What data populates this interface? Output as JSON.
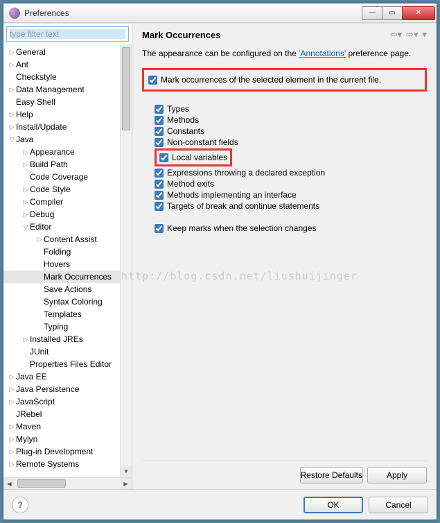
{
  "window": {
    "title": "Preferences"
  },
  "filter": {
    "placeholder": "type filter text"
  },
  "tree": [
    {
      "label": "General",
      "lvl": 0,
      "arrow": "right"
    },
    {
      "label": "Ant",
      "lvl": 0,
      "arrow": "right"
    },
    {
      "label": "Checkstyle",
      "lvl": 0,
      "arrow": "none"
    },
    {
      "label": "Data Management",
      "lvl": 0,
      "arrow": "right"
    },
    {
      "label": "Easy Shell",
      "lvl": 0,
      "arrow": "none"
    },
    {
      "label": "Help",
      "lvl": 0,
      "arrow": "right"
    },
    {
      "label": "Install/Update",
      "lvl": 0,
      "arrow": "right"
    },
    {
      "label": "Java",
      "lvl": 0,
      "arrow": "down"
    },
    {
      "label": "Appearance",
      "lvl": 1,
      "arrow": "right"
    },
    {
      "label": "Build Path",
      "lvl": 1,
      "arrow": "right"
    },
    {
      "label": "Code Coverage",
      "lvl": 1,
      "arrow": "none"
    },
    {
      "label": "Code Style",
      "lvl": 1,
      "arrow": "right"
    },
    {
      "label": "Compiler",
      "lvl": 1,
      "arrow": "right"
    },
    {
      "label": "Debug",
      "lvl": 1,
      "arrow": "right"
    },
    {
      "label": "Editor",
      "lvl": 1,
      "arrow": "down"
    },
    {
      "label": "Content Assist",
      "lvl": 2,
      "arrow": "right"
    },
    {
      "label": "Folding",
      "lvl": 2,
      "arrow": "none"
    },
    {
      "label": "Hovers",
      "lvl": 2,
      "arrow": "none"
    },
    {
      "label": "Mark Occurrences",
      "lvl": 2,
      "arrow": "none",
      "selected": true
    },
    {
      "label": "Save Actions",
      "lvl": 2,
      "arrow": "none"
    },
    {
      "label": "Syntax Coloring",
      "lvl": 2,
      "arrow": "none"
    },
    {
      "label": "Templates",
      "lvl": 2,
      "arrow": "none"
    },
    {
      "label": "Typing",
      "lvl": 2,
      "arrow": "none"
    },
    {
      "label": "Installed JREs",
      "lvl": 1,
      "arrow": "right"
    },
    {
      "label": "JUnit",
      "lvl": 1,
      "arrow": "none"
    },
    {
      "label": "Properties Files Editor",
      "lvl": 1,
      "arrow": "none"
    },
    {
      "label": "Java EE",
      "lvl": 0,
      "arrow": "right"
    },
    {
      "label": "Java Persistence",
      "lvl": 0,
      "arrow": "right"
    },
    {
      "label": "JavaScript",
      "lvl": 0,
      "arrow": "right"
    },
    {
      "label": "JRebel",
      "lvl": 0,
      "arrow": "none"
    },
    {
      "label": "Maven",
      "lvl": 0,
      "arrow": "right"
    },
    {
      "label": "Mylyn",
      "lvl": 0,
      "arrow": "right"
    },
    {
      "label": "Plug-in Development",
      "lvl": 0,
      "arrow": "right"
    },
    {
      "label": "Remote Systems",
      "lvl": 0,
      "arrow": "right"
    }
  ],
  "page": {
    "title": "Mark Occurrences",
    "desc_prefix": "The appearance can be configured on the ",
    "desc_link": "'Annotations'",
    "desc_suffix": " preference page.",
    "master": "Mark occurrences of the selected element in the current file.",
    "options": [
      "Types",
      "Methods",
      "Constants",
      "Non-constant fields",
      "Local variables",
      "Expressions throwing a declared exception",
      "Method exits",
      "Methods implementing an interface",
      "Targets of break and continue statements"
    ],
    "keep": "Keep marks when the selection changes"
  },
  "buttons": {
    "restore": "Restore Defaults",
    "apply": "Apply",
    "ok": "OK",
    "cancel": "Cancel"
  },
  "watermark": "http://blog.csdn.net/liushuijinger"
}
